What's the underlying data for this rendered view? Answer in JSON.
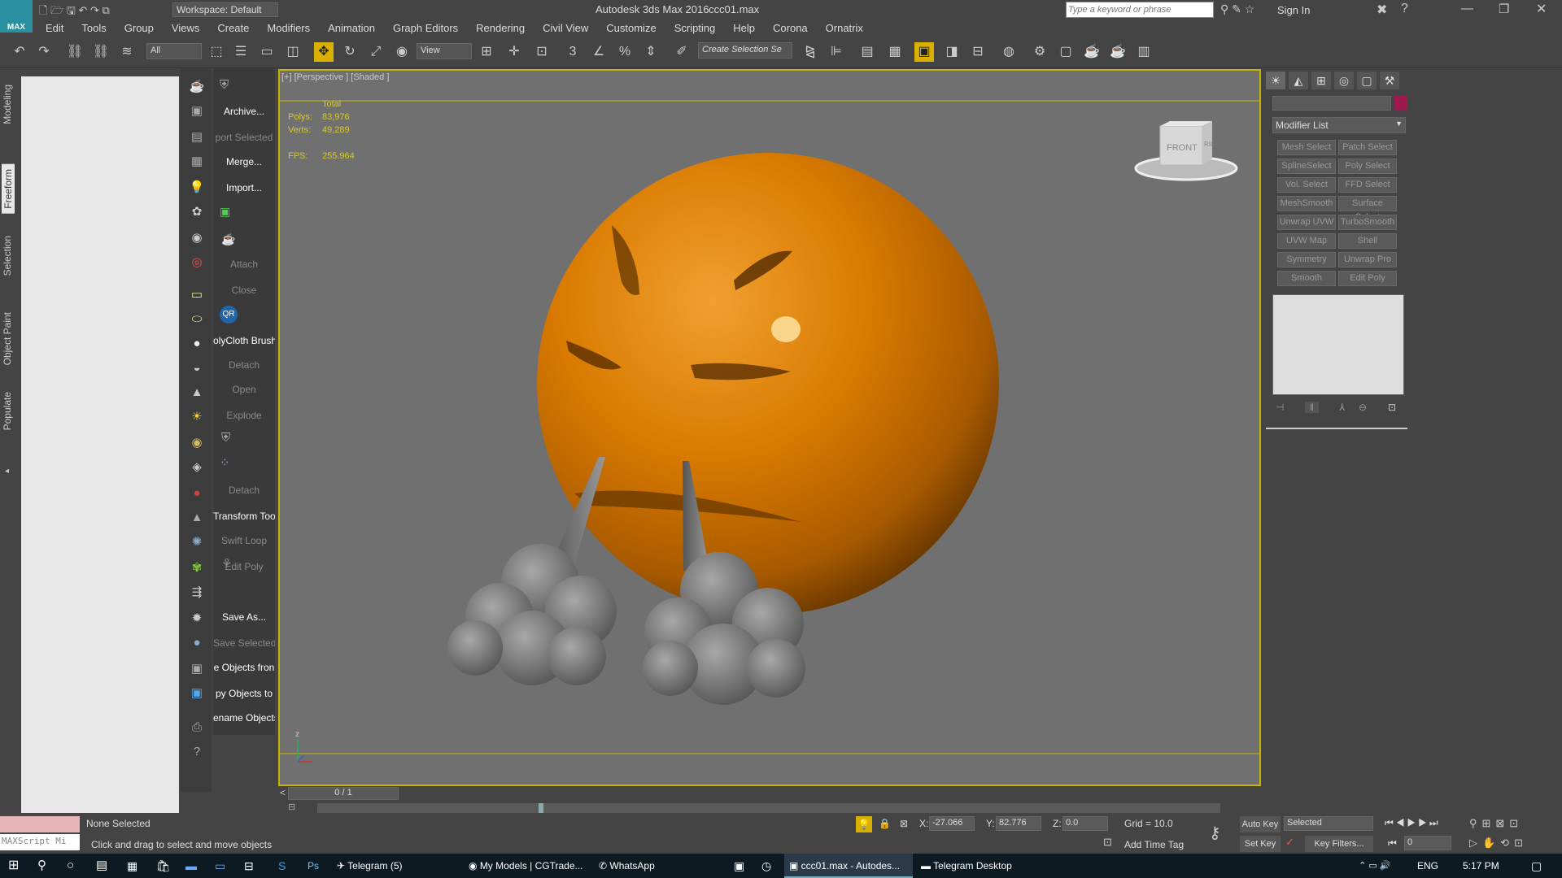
{
  "title": {
    "app": "Autodesk 3ds Max 2016",
    "file": "ccc01.max",
    "workspace": "Workspace: Default",
    "search_placeholder": "Type a keyword or phrase",
    "sign_in": "Sign In",
    "logo": "MAX"
  },
  "menu": [
    "Edit",
    "Tools",
    "Group",
    "Views",
    "Create",
    "Modifiers",
    "Animation",
    "Graph Editors",
    "Rendering",
    "Civil View",
    "Customize",
    "Scripting",
    "Help",
    "Corona",
    "Ornatrix"
  ],
  "toolbar": {
    "filter": "All",
    "ref_coord": "View",
    "selection_set": "Create Selection Se"
  },
  "ribbon_tabs": [
    "Modeling",
    "Freeform",
    "Selection",
    "Object Paint",
    "Populate"
  ],
  "commands": [
    {
      "label": "Archive...",
      "on": true
    },
    {
      "label": "port Selected",
      "on": false
    },
    {
      "label": "Merge...",
      "on": true
    },
    {
      "label": "Import...",
      "on": true
    },
    {
      "label": "Attach",
      "on": false
    },
    {
      "label": "Close",
      "on": false
    },
    {
      "label": "olyCloth Brush",
      "on": true
    },
    {
      "label": "Detach",
      "on": false
    },
    {
      "label": "Open",
      "on": false
    },
    {
      "label": "Explode",
      "on": false
    },
    {
      "label": "Detach",
      "on": false
    },
    {
      "label": "Transform Tool",
      "on": true
    },
    {
      "label": "Swift Loop",
      "on": false
    },
    {
      "label": "Edit Poly",
      "on": false
    },
    {
      "label": "Save As...",
      "on": true
    },
    {
      "label": "Save Selected",
      "on": false
    },
    {
      "label": "e Objects fron",
      "on": true
    },
    {
      "label": "py Objects to",
      "on": true
    },
    {
      "label": "ename Objects",
      "on": true
    }
  ],
  "viewport": {
    "label": "[+] [Perspective ] [Shaded ]",
    "stats_total": "Total",
    "polys_label": "Polys:",
    "polys": "83,976",
    "verts_label": "Verts:",
    "verts": "49,289",
    "fps_label": "FPS:",
    "fps": "255.964",
    "viewcube_front": "FRONT",
    "viewcube_right": "RIF",
    "axis_z": "z"
  },
  "time_slider": "0 / 1",
  "command_panel": {
    "modifier_list": "Modifier List",
    "modifiers": [
      "Mesh Select",
      "Patch Select",
      "SplineSelect",
      "Poly Select",
      "Vol. Select",
      "FFD Select",
      "MeshSmooth",
      "Surface Select",
      "Unwrap UVW",
      "TurboSmooth",
      "UVW Map",
      "Shell",
      "Symmetry",
      "Unwrap Pro",
      "Smooth",
      "Edit Poly"
    ]
  },
  "status": {
    "script_label": "MAXScript Mi",
    "selection": "None Selected",
    "prompt": "Click and drag to select and move objects",
    "x_label": "X:",
    "x": "-27.066",
    "y_label": "Y:",
    "y": "82.776",
    "z_label": "Z:",
    "z": "0.0",
    "grid": "Grid = 10.0",
    "add_time_tag": "Add Time Tag",
    "auto_key": "Auto Key",
    "set_key": "Set Key",
    "key_mode": "Selected",
    "key_filters": "Key Filters...",
    "frame": "0"
  },
  "taskbar": {
    "items": [
      "Telegram (5)",
      "My Models | CGTrade...",
      "WhatsApp",
      "ccc01.max - Autodes...",
      "Telegram Desktop"
    ],
    "lang": "ENG",
    "time": "5:17 PM"
  },
  "colors": {
    "emoji": "#d97a00",
    "viewport_bg": "#707070",
    "viewport_border": "#c8b400",
    "object_color": "#9e1950"
  }
}
